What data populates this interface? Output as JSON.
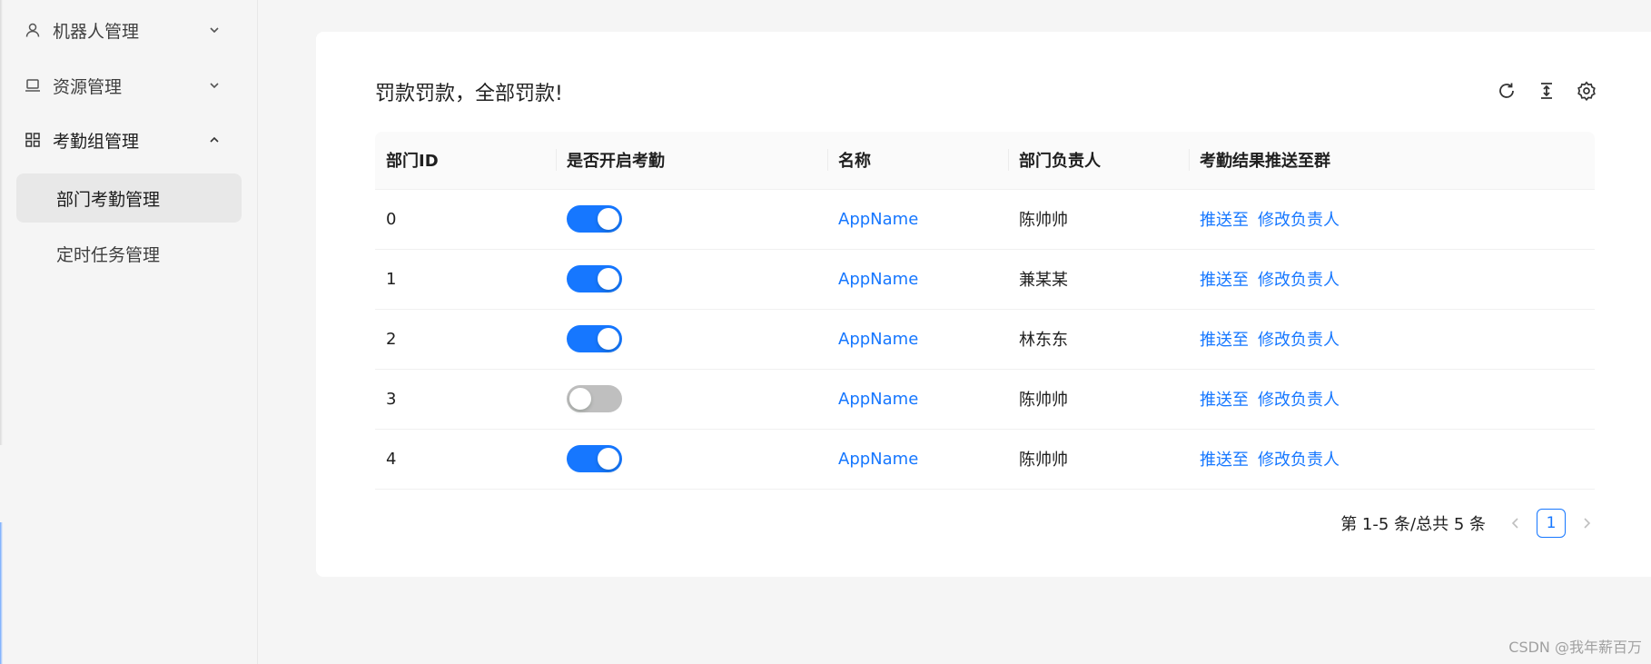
{
  "sidebar": {
    "menus": [
      {
        "label": "机器人管理",
        "icon": "user-icon",
        "expanded": false
      },
      {
        "label": "资源管理",
        "icon": "laptop-icon",
        "expanded": false
      },
      {
        "label": "考勤组管理",
        "icon": "appstore-icon",
        "expanded": true
      }
    ],
    "sub_items": [
      {
        "label": "部门考勤管理",
        "selected": true
      },
      {
        "label": "定时任务管理",
        "selected": false
      }
    ]
  },
  "card": {
    "title": "罚款罚款，全部罚款!",
    "toolbar": [
      "reload-icon",
      "density-icon",
      "setting-icon"
    ]
  },
  "table": {
    "headers": [
      "部门ID",
      "是否开启考勤",
      "名称",
      "部门负责人",
      "考勤结果推送至群"
    ],
    "rows": [
      {
        "id": "0",
        "enabled": true,
        "name": "AppName",
        "owner": "陈帅帅",
        "action1": "推送至",
        "action2": "修改负责人"
      },
      {
        "id": "1",
        "enabled": true,
        "name": "AppName",
        "owner": "兼某某",
        "action1": "推送至",
        "action2": "修改负责人"
      },
      {
        "id": "2",
        "enabled": true,
        "name": "AppName",
        "owner": "林东东",
        "action1": "推送至",
        "action2": "修改负责人"
      },
      {
        "id": "3",
        "enabled": false,
        "name": "AppName",
        "owner": "陈帅帅",
        "action1": "推送至",
        "action2": "修改负责人"
      },
      {
        "id": "4",
        "enabled": true,
        "name": "AppName",
        "owner": "陈帅帅",
        "action1": "推送至",
        "action2": "修改负责人"
      }
    ]
  },
  "pagination": {
    "total_text": "第 1-5 条/总共 5 条",
    "current_page": "1"
  },
  "watermark": "CSDN @我年薪百万",
  "colors": {
    "primary": "#1677ff",
    "switch_off": "#bfbfbf",
    "background": "#f5f5f5"
  }
}
